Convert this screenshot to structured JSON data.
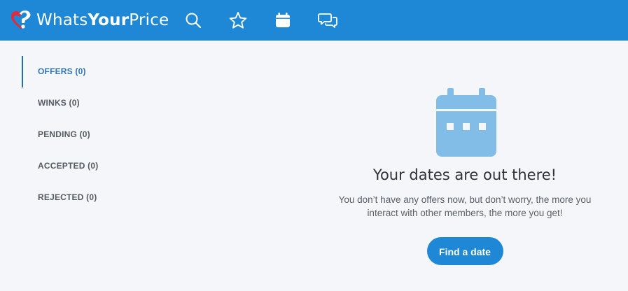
{
  "header": {
    "logo": {
      "part1": "Whats",
      "part2": "Your",
      "part3": "Price"
    },
    "nav": [
      {
        "icon": "search-icon"
      },
      {
        "icon": "star-icon"
      },
      {
        "icon": "calendar-icon"
      },
      {
        "icon": "chat-icon"
      }
    ],
    "bar_color": "#1e88d6"
  },
  "sidebar": {
    "items": [
      {
        "label": "OFFERS (0)",
        "active": true
      },
      {
        "label": "WINKS (0)",
        "active": false
      },
      {
        "label": "PENDING (0)",
        "active": false
      },
      {
        "label": "ACCEPTED (0)",
        "active": false
      },
      {
        "label": "REJECTED (0)",
        "active": false
      }
    ]
  },
  "main": {
    "illustration": "calendar-icon",
    "title": "Your dates are out there!",
    "description": "You don’t have any offers now, but don’t worry, the more you interact with other members, the more you get!",
    "button_label": "Find a date"
  },
  "colors": {
    "accent": "#1e88d6",
    "illustration": "#82bde8",
    "active_tab": "#2f74b5",
    "background": "#f5f6fa"
  }
}
